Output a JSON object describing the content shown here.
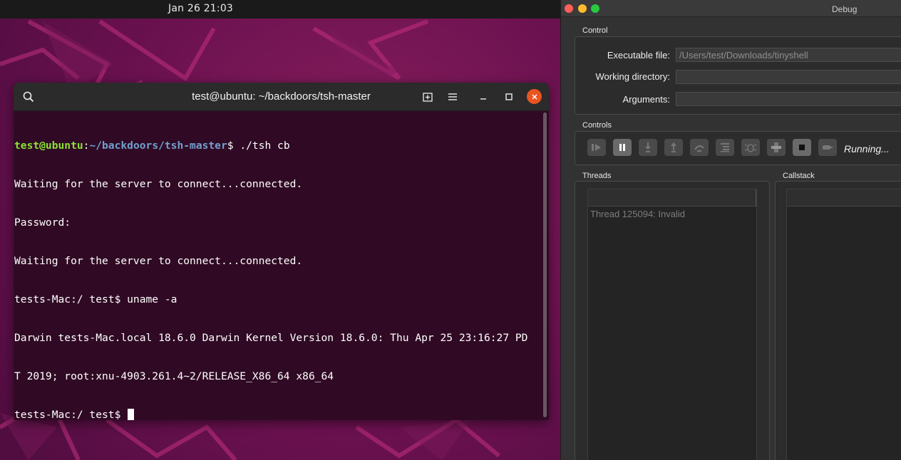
{
  "topbar": {
    "clock": "Jan 26  21:03"
  },
  "terminal": {
    "title": "test@ubuntu: ~/backdoors/tsh-master",
    "prompt_user": "test@ubuntu",
    "prompt_sep": ":",
    "prompt_path": "~/backdoors/tsh-master",
    "prompt_cmd": "$ ./tsh cb",
    "lines": [
      "Waiting for the server to connect...connected.",
      "Password:",
      "Waiting for the server to connect...connected.",
      "tests-Mac:/ test$ uname -a",
      "Darwin tests-Mac.local 18.6.0 Darwin Kernel Version 18.6.0: Thu Apr 25 23:16:27 PD",
      "T 2019; root:xnu-4903.261.4~2/RELEASE_X86_64 x86_64"
    ],
    "last_prompt": "tests-Mac:/ test$ "
  },
  "debug": {
    "window_title": "Debug",
    "control_group": "Control",
    "executable_label": "Executable file:",
    "executable_value": "/Users/test/Downloads/tinyshell",
    "working_dir_label": "Working directory:",
    "working_dir_value": "",
    "arguments_label": "Arguments:",
    "arguments_value": "",
    "controls_group": "Controls",
    "status": "Running...",
    "threads_label": "Threads",
    "callstack_label": "Callstack",
    "thread_item": "Thread 125094: Invalid"
  },
  "colors": {
    "terminal_bg": "#300a24",
    "prompt_user": "#8ae234",
    "prompt_path": "#729fcf",
    "close_button": "#e95420",
    "traffic_red": "#fe5f57",
    "traffic_yellow": "#febc2e",
    "traffic_green": "#28c840"
  },
  "icons": {
    "terminal": [
      "search-icon",
      "new-tab-icon",
      "hamburger-menu-icon",
      "minimize-icon",
      "maximize-icon",
      "close-icon"
    ],
    "debug_controls": [
      "play-icon",
      "pause-icon",
      "step-into-icon",
      "step-out-icon",
      "step-over-icon",
      "list-icon",
      "bug-icon",
      "puzzle-icon",
      "stop-icon",
      "detach-icon"
    ]
  }
}
